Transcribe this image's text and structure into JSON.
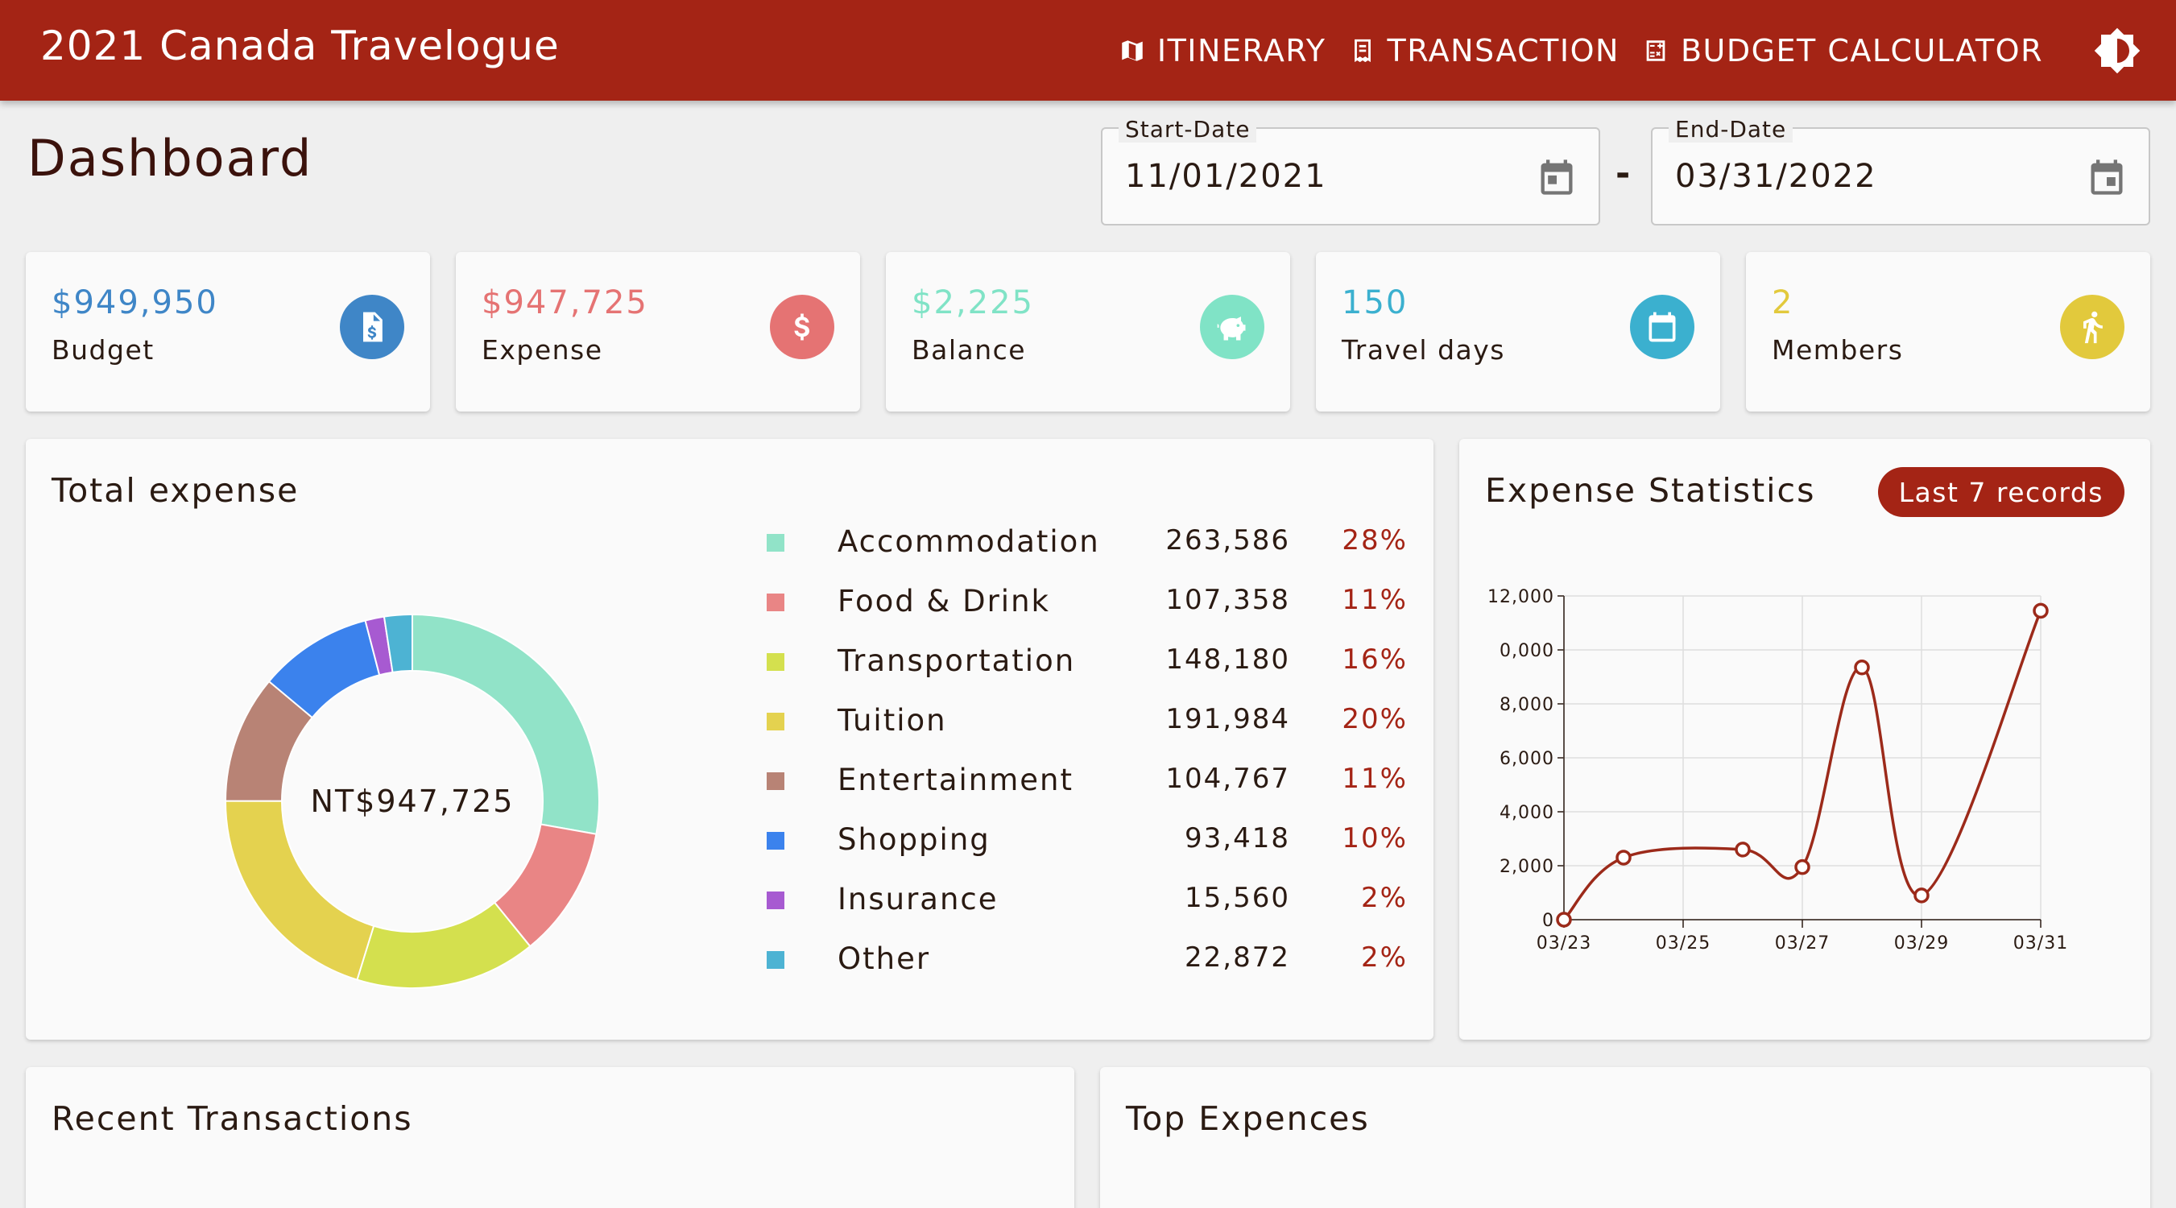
{
  "app": {
    "title": "2021 Canada Travelogue",
    "nav": [
      {
        "label": "ITINERARY",
        "icon": "map-icon"
      },
      {
        "label": "TRANSACTION",
        "icon": "receipt-icon"
      },
      {
        "label": "BUDGET CALCULATOR",
        "icon": "calculator-icon"
      }
    ],
    "theme_icon": "brightness-icon"
  },
  "page": {
    "title": "Dashboard",
    "start_date": {
      "label": "Start-Date",
      "value": "11/01/2021"
    },
    "end_date": {
      "label": "End-Date",
      "value": "03/31/2022"
    },
    "separator": "-"
  },
  "stats": [
    {
      "value": "$949,950",
      "label": "Budget",
      "color": "#3f86c7",
      "icon": "invoice-dollar-icon"
    },
    {
      "value": "$947,725",
      "label": "Expense",
      "color": "#e57373",
      "icon": "dollar-icon"
    },
    {
      "value": "$2,225",
      "label": "Balance",
      "color": "#80e3c6",
      "icon": "piggy-bank-icon"
    },
    {
      "value": "150",
      "label": "Travel days",
      "color": "#3bb0cf",
      "icon": "calendar-icon"
    },
    {
      "value": "2",
      "label": "Members",
      "color": "#e2c93c",
      "icon": "person-walking-icon"
    }
  ],
  "total_expense": {
    "title": "Total expense",
    "center_label": "NT$947,725",
    "chart_data": {
      "type": "pie",
      "categories": [
        "Accommodation",
        "Food & Drink",
        "Transportation",
        "Tuition",
        "Entertainment",
        "Shopping",
        "Insurance",
        "Other"
      ],
      "values": [
        263586,
        107358,
        148180,
        191984,
        104767,
        93418,
        15560,
        22872
      ],
      "percentages": [
        "28%",
        "11%",
        "16%",
        "20%",
        "11%",
        "10%",
        "2%",
        "2%"
      ],
      "amounts": [
        "263,586",
        "107,358",
        "148,180",
        "191,984",
        "104,767",
        "93,418",
        "15,560",
        "22,872"
      ],
      "colors": [
        "#91e3c8",
        "#e98585",
        "#d4e04e",
        "#e4d24f",
        "#b88375",
        "#3b82ed",
        "#a75ad1",
        "#4db3d3"
      ],
      "donut": true
    }
  },
  "expense_stats": {
    "title": "Expense Statistics",
    "chip": "Last 7 records",
    "chart_data": {
      "type": "line",
      "x": [
        "03/23",
        "03/24",
        "03/25",
        "03/26",
        "03/27",
        "03/28",
        "03/29",
        "03/30",
        "03/31"
      ],
      "values": [
        0,
        2300,
        null,
        2600,
        1950,
        9350,
        900,
        null,
        11450
      ],
      "xticks": [
        "03/23",
        "03/25",
        "03/27",
        "03/29",
        "03/31"
      ],
      "yticks": [
        "0",
        "2,000",
        "4,000",
        "6,000",
        "8,000",
        "0,000",
        "12,000"
      ],
      "ylim": [
        0,
        12000
      ],
      "grid": true,
      "color": "#9c2a1a"
    }
  },
  "recent": {
    "title": "Recent Transactions"
  },
  "top": {
    "title": "Top Expences"
  }
}
